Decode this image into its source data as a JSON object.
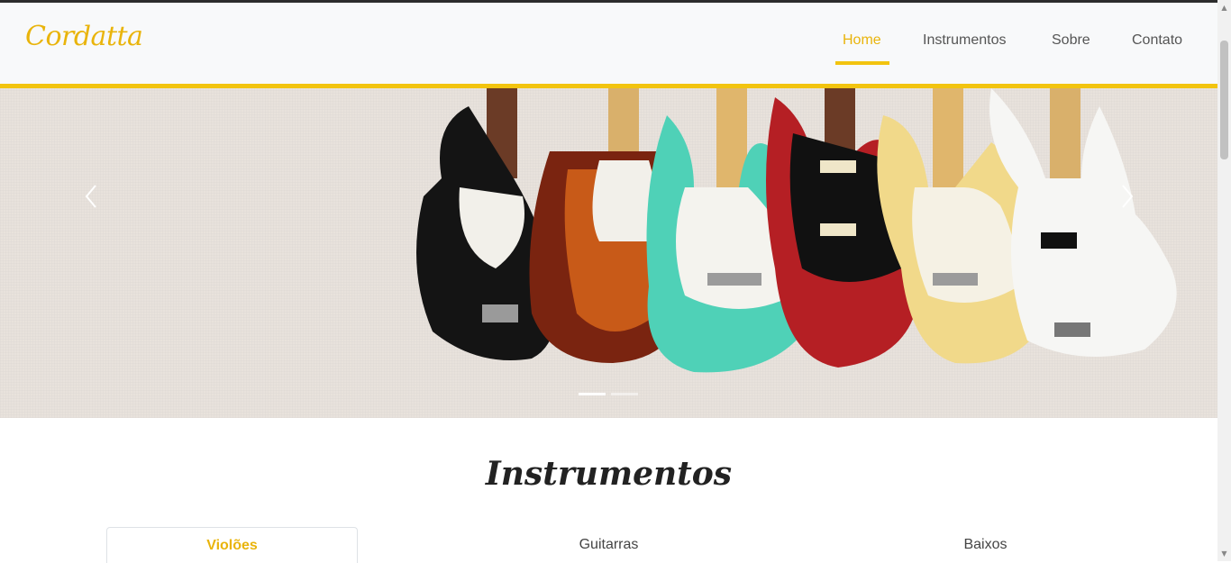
{
  "brand": {
    "logo_text": "Cordatta",
    "accent_color": "#f2c40f"
  },
  "nav": {
    "items": [
      {
        "label": "Home",
        "active": true
      },
      {
        "label": "Instrumentos",
        "active": false
      },
      {
        "label": "Sobre",
        "active": false
      },
      {
        "label": "Contato",
        "active": false
      }
    ]
  },
  "carousel": {
    "prev_icon": "chevron-left-icon",
    "next_icon": "chevron-right-icon",
    "slides": [
      {
        "image": "electric-guitars-and-basses-lineup",
        "active": true
      },
      {
        "image": "slide-2",
        "active": false
      }
    ]
  },
  "instruments": {
    "title": "Instrumentos",
    "tabs": [
      {
        "label": "Violões",
        "active": true
      },
      {
        "label": "Guitarras",
        "active": false
      },
      {
        "label": "Baixos",
        "active": false
      }
    ]
  }
}
